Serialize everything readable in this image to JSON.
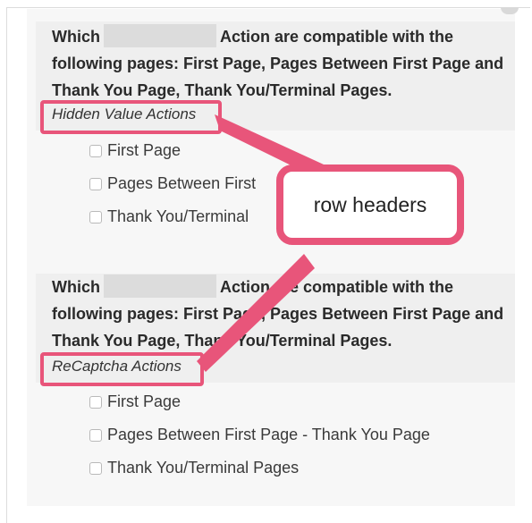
{
  "question1": {
    "text_before": "Which",
    "text_after": "Action are compatible with the following pages: First Page, Pages Between First Page and Thank You Page, Thank You/Terminal Pages.",
    "row_header": "Hidden Value Actions",
    "options": [
      "First Page",
      "Pages Between First",
      "Thank You/Terminal"
    ]
  },
  "question2": {
    "text_before": "Which",
    "text_after": "Action are compatible with the following pages: First Page, Pages Between First Page and Thank You Page, Thank You/Terminal Pages.",
    "row_header": "ReCaptcha Actions",
    "options": [
      "First Page",
      "Pages Between First Page - Thank You Page",
      "Thank You/Terminal Pages"
    ]
  },
  "callout": {
    "label": "row headers"
  },
  "colors": {
    "highlight": "#e8557a",
    "panel": "#efefef"
  }
}
